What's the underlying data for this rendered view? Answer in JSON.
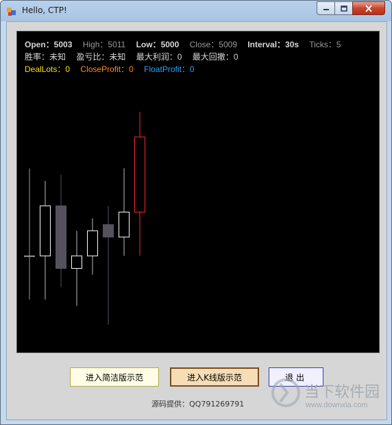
{
  "window": {
    "title": "Hello, CTP!"
  },
  "info": {
    "row1": [
      {
        "label": "Open：",
        "value": "5003",
        "color": "gray_bright"
      },
      {
        "label": "High：",
        "value": "5011",
        "color": "gray"
      },
      {
        "label": "Low：",
        "value": "5000",
        "color": "gray_bright"
      },
      {
        "label": "Close：",
        "value": "5009",
        "color": "gray"
      },
      {
        "label": "Interval：",
        "value": "30s",
        "color": "gray_bright"
      },
      {
        "label": "Ticks：",
        "value": "5",
        "color": "gray"
      }
    ],
    "row2": [
      {
        "label": "胜率：",
        "value": "未知"
      },
      {
        "label": "盈亏比：",
        "value": "未知"
      },
      {
        "label": "最大利润：",
        "value": "0"
      },
      {
        "label": "最大回撤：",
        "value": "0"
      }
    ],
    "row3": {
      "deal_label": "DealLots：",
      "deal_value": "0",
      "close_label": "CloseProfit：",
      "close_value": "0",
      "float_label": "FloatProfit：",
      "float_value": "0"
    }
  },
  "candles": [
    {
      "open": 4988,
      "close": 4988,
      "high": 5002,
      "low": 4981,
      "color": "#9a9a9a"
    },
    {
      "open": 4988,
      "close": 4996,
      "high": 5000,
      "low": 4981,
      "color": "#ffffff",
      "hollow": true
    },
    {
      "open": 4996,
      "close": 4986,
      "high": 5001,
      "low": 4983,
      "color": "#55525e",
      "hollow": false
    },
    {
      "open": 4986,
      "close": 4988,
      "high": 4992,
      "low": 4980,
      "color": "#ffffff",
      "hollow": true
    },
    {
      "open": 4988,
      "close": 4992,
      "high": 4994,
      "low": 4985,
      "color": "#ffffff",
      "hollow": true
    },
    {
      "open": 4993,
      "close": 4991,
      "high": 4996,
      "low": 4977,
      "color": "#55525e",
      "hollow": false
    },
    {
      "open": 4991,
      "close": 4995,
      "high": 5002,
      "low": 4988,
      "color": "#ffffff",
      "hollow": true
    },
    {
      "open": 4995,
      "close": 5007,
      "high": 5011,
      "low": 4988,
      "color": "#ff2a2a",
      "hollow": true
    }
  ],
  "buttons": {
    "simple": "进入简洁版示范",
    "kline": "进入K线版示范",
    "exit": "退出"
  },
  "source_text": "源码提供：QQ791269791",
  "watermark": {
    "title": "当下软件园",
    "url": "www.downxia.com"
  },
  "colors": {
    "chart_bg": "#000000",
    "up": "#ff2a2a",
    "down": "#55525e",
    "accent_yellow": "#ffe000",
    "accent_orange": "#ff8c1a",
    "accent_blue": "#2aa4ff"
  }
}
